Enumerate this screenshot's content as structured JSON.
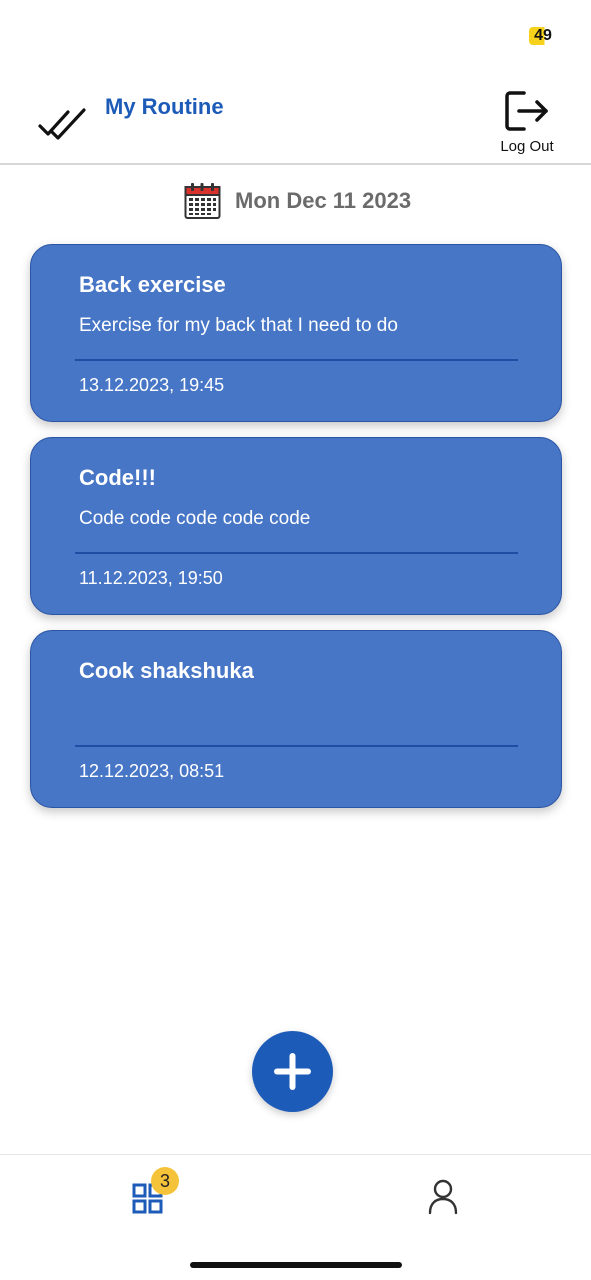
{
  "status_bar": {
    "battery_level": "49"
  },
  "header": {
    "logo_icon": "double-check-icon",
    "title": "My Routine",
    "logout_icon": "logout-icon",
    "logout_label": "Log Out"
  },
  "date_bar": {
    "icon": "calendar-icon",
    "date": "Mon Dec 11 2023"
  },
  "tasks": [
    {
      "title": "Back exercise",
      "description": "Exercise for my back that I need to do",
      "datetime": "13.12.2023, 19:45"
    },
    {
      "title": "Code!!!",
      "description": "Code code code code code",
      "datetime": "11.12.2023, 19:50"
    },
    {
      "title": "Cook shakshuka",
      "description": "",
      "datetime": "12.12.2023, 08:51"
    }
  ],
  "fab": {
    "icon": "plus-icon"
  },
  "bottom_nav": {
    "tasks_icon": "grid-icon",
    "tasks_badge": "3",
    "profile_icon": "user-icon"
  },
  "colors": {
    "primary": "#1d5bb8",
    "card_background": "#4776c6",
    "badge": "#f5c33a",
    "battery": "#f7d21c"
  }
}
